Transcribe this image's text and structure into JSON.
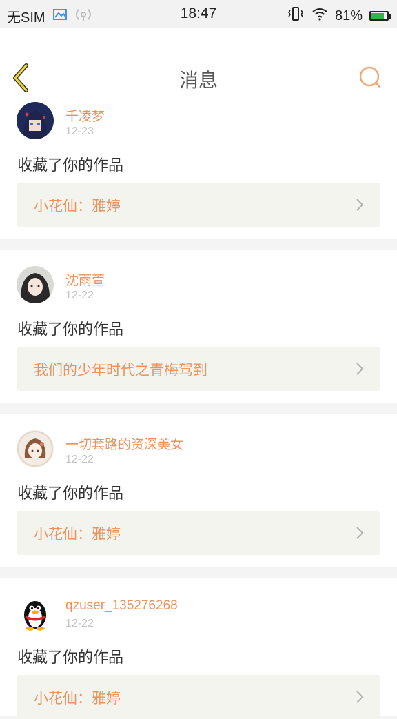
{
  "status_bar": {
    "carrier": "无SIM",
    "time": "18:47",
    "battery_percent_text": "81%",
    "battery_level": 0.81,
    "icons": [
      "gallery-icon",
      "signal-icon",
      "vibrate-icon",
      "wifi-icon",
      "battery-icon"
    ]
  },
  "header": {
    "title": "消息",
    "back_icon": "back-chevron-icon",
    "search_icon": "search-icon",
    "accent_color": "#e8935f"
  },
  "messages": [
    {
      "user": "千凌梦",
      "date": "12-23",
      "action": "收藏了你的作品",
      "work": "小花仙：雅婷"
    },
    {
      "user": "沈雨萱",
      "date": "12-22",
      "action": "收藏了你的作品",
      "work": "我们的少年时代之青梅驾到"
    },
    {
      "user": "一切套路的资深美女",
      "date": "12-22",
      "action": "收藏了你的作品",
      "work": "小花仙：雅婷"
    },
    {
      "user": "qzuser_135276268",
      "date": "12-22",
      "action": "收藏了你的作品",
      "work": "小花仙：雅婷"
    }
  ]
}
